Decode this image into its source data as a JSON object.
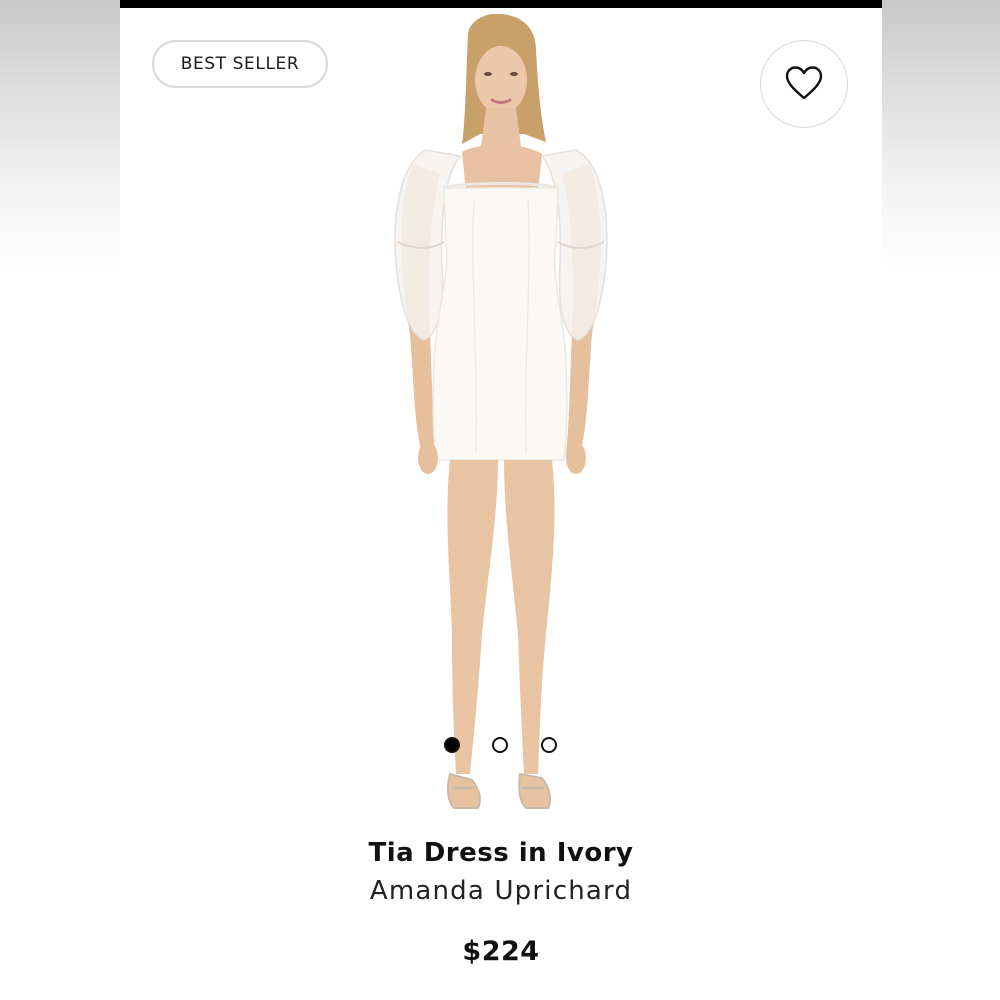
{
  "badge": {
    "label": "BEST SELLER"
  },
  "favorite": {
    "icon": "heart-icon"
  },
  "product": {
    "name": "Tia Dress in Ivory",
    "brand": "Amanda Uprichard",
    "price": "$224",
    "image": "model-in-white-mini-dress"
  },
  "carousel": {
    "current": 1,
    "total": 3
  },
  "colors": {
    "accent": "#000000",
    "dress": "#fbf9f5",
    "skin": "#e8c7a8"
  }
}
